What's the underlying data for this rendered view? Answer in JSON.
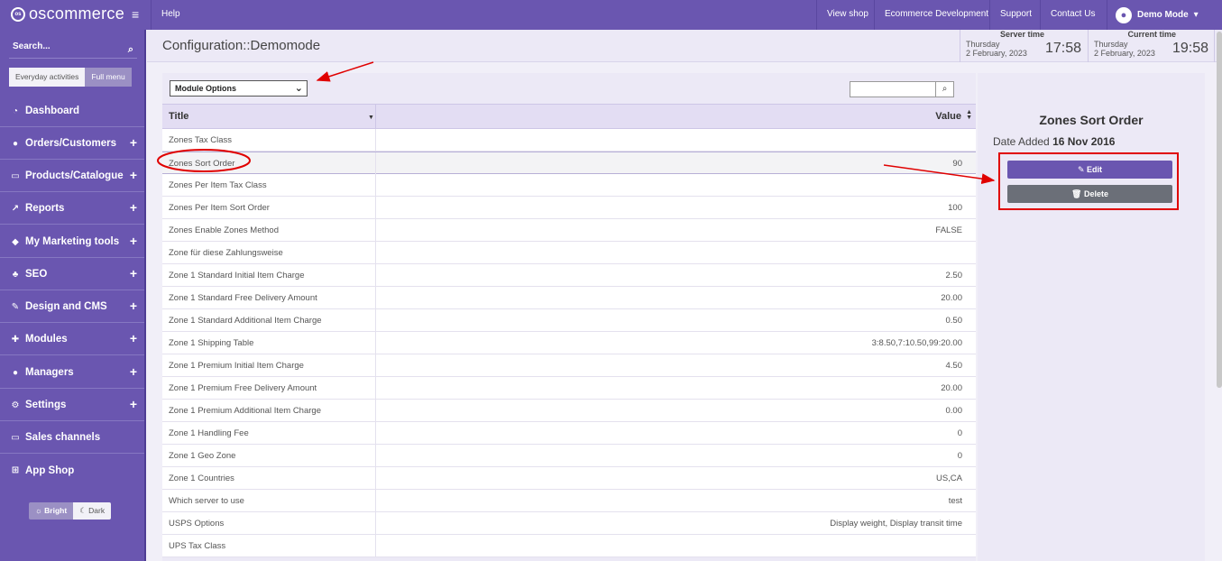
{
  "topbar": {
    "logo_text": "oscommerce",
    "help": "Help",
    "links": [
      "View shop",
      "Ecommerce Development",
      "Support",
      "Contact Us"
    ],
    "user_label": "Demo Mode"
  },
  "sidebar": {
    "search_label": "Search...",
    "toggle_everyday": "Everyday activities",
    "toggle_full": "Full menu",
    "items": [
      {
        "label": "Dashboard",
        "icon": "dashboard-icon",
        "has_plus": false
      },
      {
        "label": "Orders/Customers",
        "icon": "users-icon",
        "has_plus": true
      },
      {
        "label": "Products/Catalogue",
        "icon": "folder-icon",
        "has_plus": true
      },
      {
        "label": "Reports",
        "icon": "chart-icon",
        "has_plus": true
      },
      {
        "label": "My Marketing tools",
        "icon": "tag-icon",
        "has_plus": true
      },
      {
        "label": "SEO",
        "icon": "sitemap-icon",
        "has_plus": true
      },
      {
        "label": "Design and CMS",
        "icon": "brush-icon",
        "has_plus": true
      },
      {
        "label": "Modules",
        "icon": "puzzle-icon",
        "has_plus": true
      },
      {
        "label": "Managers",
        "icon": "user-icon",
        "has_plus": true
      },
      {
        "label": "Settings",
        "icon": "gears-icon",
        "has_plus": true
      },
      {
        "label": "Sales channels",
        "icon": "monitor-icon",
        "has_plus": false
      },
      {
        "label": "App Shop",
        "icon": "cart-icon",
        "has_plus": false
      }
    ],
    "theme_bright": "Bright",
    "theme_dark": "Dark"
  },
  "header": {
    "title": "Configuration::Demomode",
    "server_time": {
      "label": "Server time",
      "day": "Thursday",
      "date": "2 February, 2023",
      "clock": "17:58"
    },
    "current_time": {
      "label": "Current time",
      "day": "Thursday",
      "date": "2 February, 2023",
      "clock": "19:58"
    }
  },
  "main": {
    "module_select": "Module Options",
    "columns": {
      "title": "Title",
      "value": "Value"
    },
    "rows": [
      {
        "title": "Zones Tax Class",
        "value": ""
      },
      {
        "title": "Zones Sort Order",
        "value": "90",
        "selected": true
      },
      {
        "title": "Zones Per Item Tax Class",
        "value": ""
      },
      {
        "title": "Zones Per Item Sort Order",
        "value": "100"
      },
      {
        "title": "Zones Enable Zones Method",
        "value": "FALSE"
      },
      {
        "title": "Zone für diese Zahlungsweise",
        "value": ""
      },
      {
        "title": "Zone 1 Standard Initial Item Charge",
        "value": "2.50"
      },
      {
        "title": "Zone 1 Standard Free Delivery Amount",
        "value": "20.00"
      },
      {
        "title": "Zone 1 Standard Additional Item Charge",
        "value": "0.50"
      },
      {
        "title": "Zone 1 Shipping Table",
        "value": "3:8.50,7:10.50,99:20.00"
      },
      {
        "title": "Zone 1 Premium Initial Item Charge",
        "value": "4.50"
      },
      {
        "title": "Zone 1 Premium Free Delivery Amount",
        "value": "20.00"
      },
      {
        "title": "Zone 1 Premium Additional Item Charge",
        "value": "0.00"
      },
      {
        "title": "Zone 1 Handling Fee",
        "value": "0"
      },
      {
        "title": "Zone 1 Geo Zone",
        "value": "0"
      },
      {
        "title": "Zone 1 Countries",
        "value": "US,CA"
      },
      {
        "title": "Which server to use",
        "value": "test"
      },
      {
        "title": "USPS Options",
        "value": "Display weight, Display transit time"
      },
      {
        "title": "UPS Tax Class",
        "value": ""
      }
    ]
  },
  "detail": {
    "title": "Zones Sort Order",
    "date_label": "Date Added",
    "date_value": "16 Nov 2016",
    "edit_label": "Edit",
    "delete_label": "Delete"
  },
  "colors": {
    "brand_purple": "#6a56b0",
    "annotation_red": "#e00000",
    "delete_grey": "#6b6f78"
  }
}
